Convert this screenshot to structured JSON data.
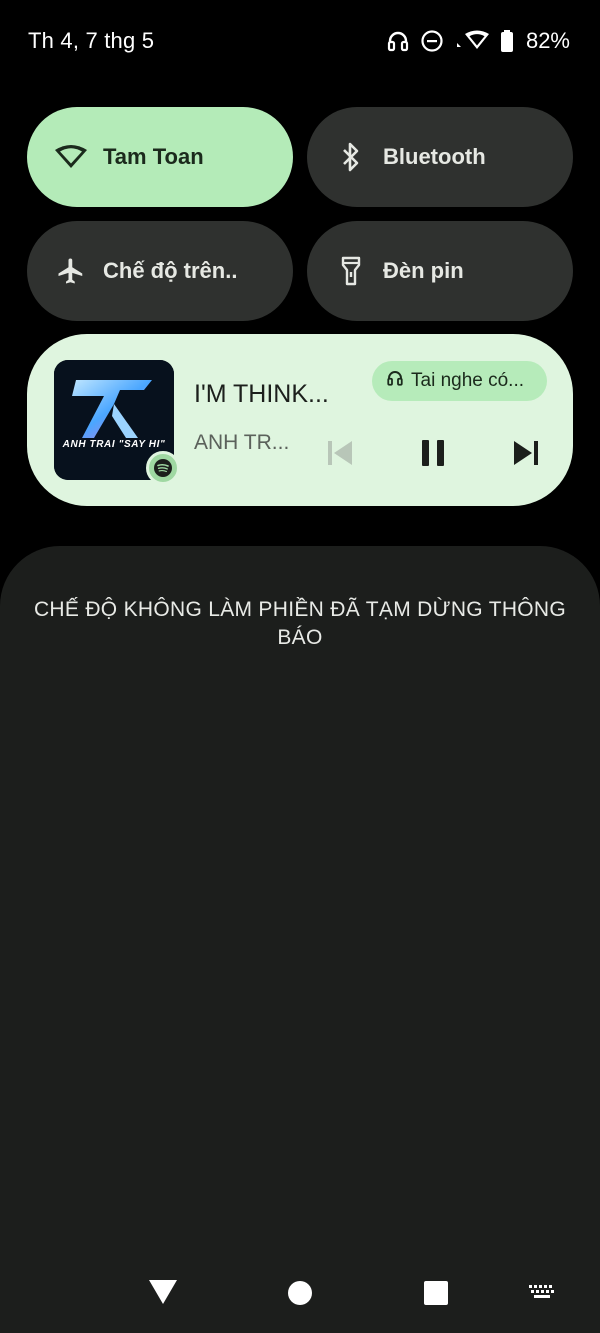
{
  "status_bar": {
    "date": "Th 4, 7 thg 5",
    "battery_percent": "82%",
    "icons": [
      "headphones-icon",
      "do-not-disturb-icon",
      "wifi-icon",
      "battery-icon"
    ]
  },
  "quick_settings": {
    "tiles": [
      {
        "label": "Tam Toan",
        "icon": "wifi-icon",
        "active": true
      },
      {
        "label": "Bluetooth",
        "icon": "bluetooth-icon",
        "active": false
      },
      {
        "label": "Chế độ trên..",
        "icon": "airplane-icon",
        "active": false
      },
      {
        "label": "Đèn pin",
        "icon": "flashlight-icon",
        "active": false
      }
    ]
  },
  "media": {
    "title": "I'M THINK...",
    "artist": "ANH TR...",
    "album_art_text": "ANH TRAI \"SAY HI\"",
    "source_app_icon": "spotify-icon",
    "output_device": "Tai nghe có...",
    "controls": [
      "previous-icon",
      "pause-icon",
      "next-icon"
    ]
  },
  "notifications": {
    "message": "CHẾ ĐỘ KHÔNG LÀM PHIỀN ĐÃ TẠM DỪNG THÔNG BÁO"
  },
  "colors": {
    "active_tile": "#b4ebb8",
    "inactive_tile": "#2f312f",
    "media_card": "#dff5df",
    "panel_background": "#1c1e1c"
  }
}
